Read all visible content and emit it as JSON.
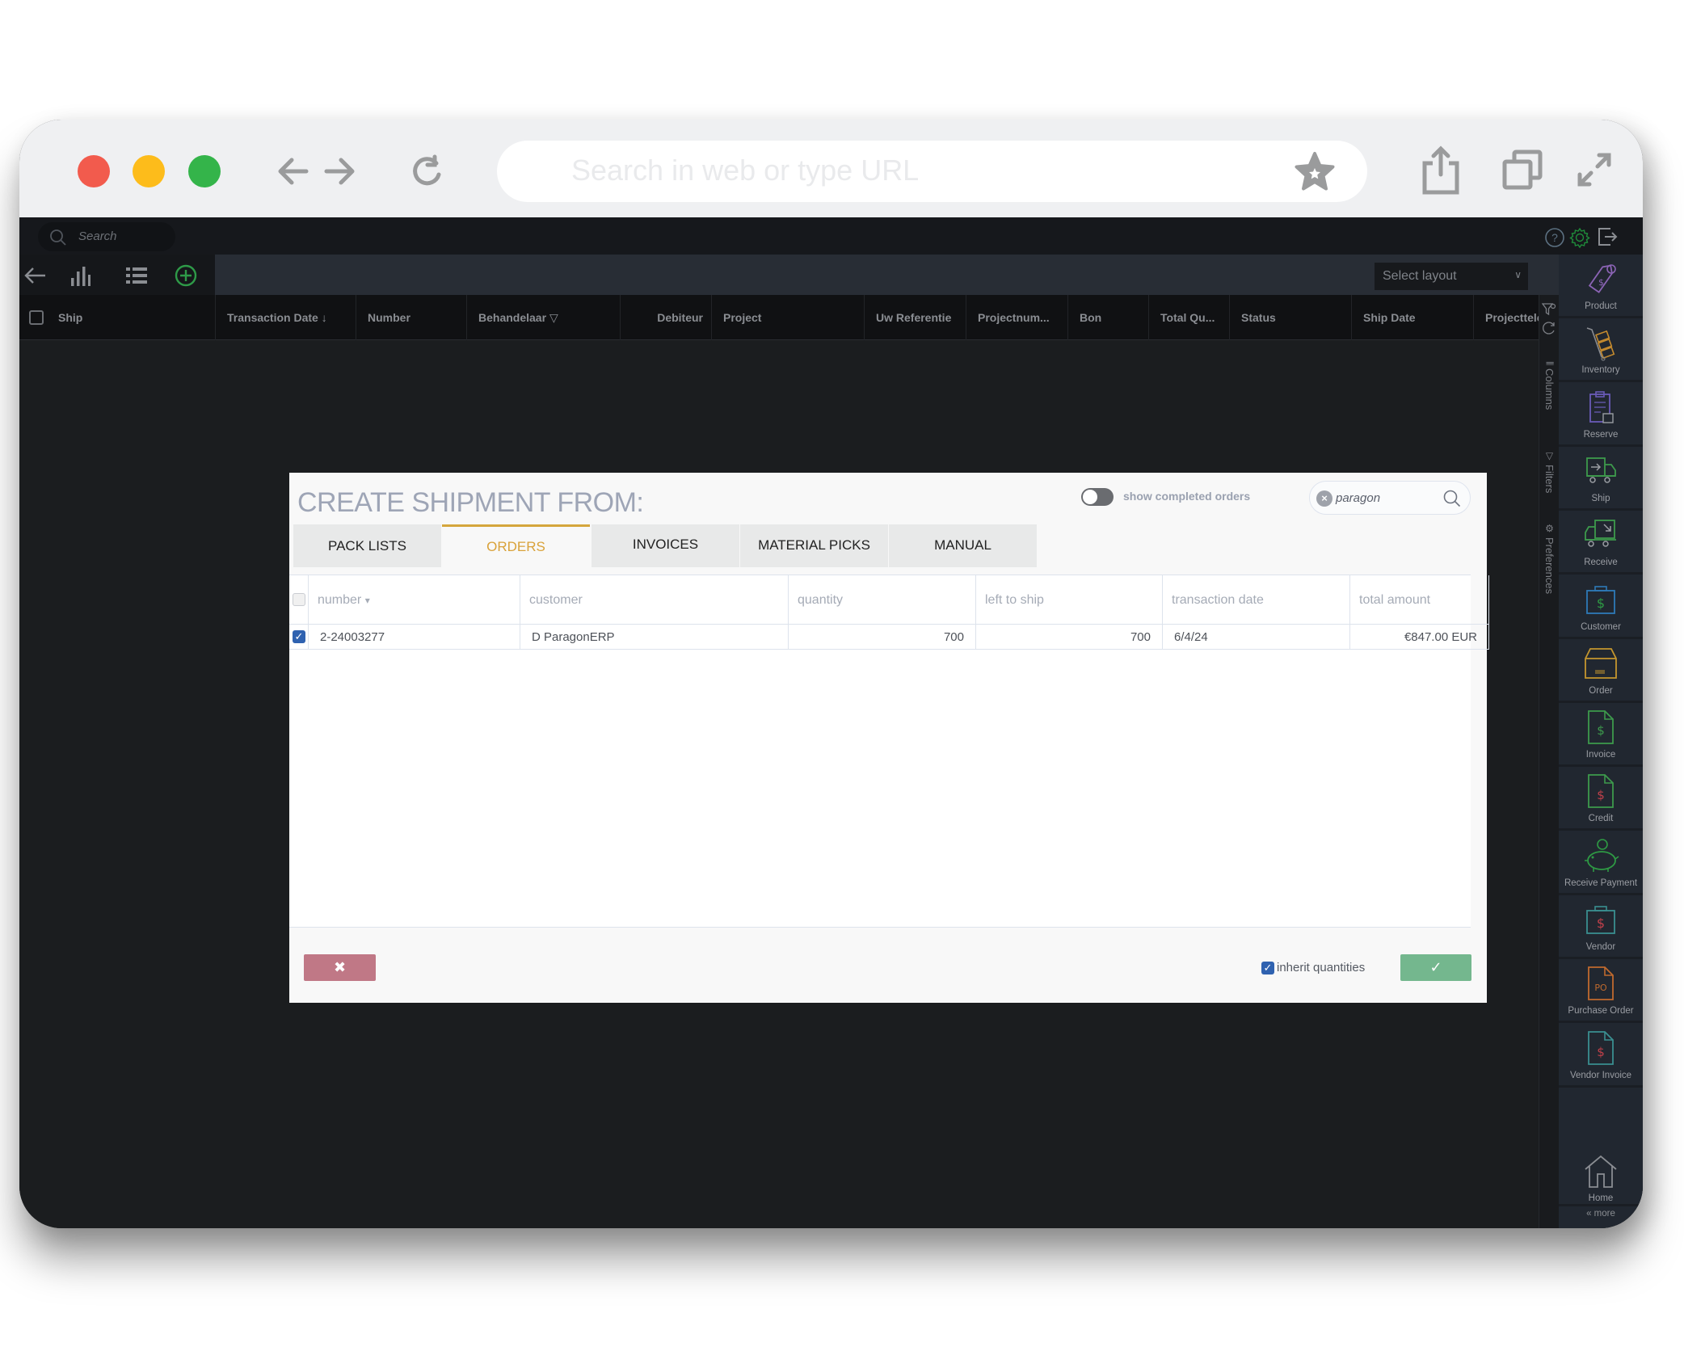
{
  "browser": {
    "url_placeholder": "Search in web or type URL",
    "traffic_lights": {
      "close": "#f25b4d",
      "minimize": "#fdbc1b",
      "maximize": "#34b44a"
    },
    "icons": [
      "back-arrow-icon",
      "forward-arrow-icon",
      "reload-icon",
      "star-icon",
      "share-icon",
      "tabs-icon",
      "fullscreen-icon"
    ]
  },
  "app": {
    "search_placeholder": "Search",
    "topbar_icons": [
      "help-icon",
      "settings-icon",
      "logout-icon"
    ],
    "toolbar_icons": [
      "back-icon",
      "chart-icon",
      "list-icon",
      "add-icon"
    ],
    "layout_select": {
      "value": "Select layout"
    },
    "columns": [
      {
        "label": "Ship"
      },
      {
        "label": "Transaction Date",
        "sort": "desc"
      },
      {
        "label": "Number"
      },
      {
        "label": "Behandelaar",
        "filter": true
      },
      {
        "label": "Debiteur"
      },
      {
        "label": "Project"
      },
      {
        "label": "Uw Referentie"
      },
      {
        "label": "Projectnum..."
      },
      {
        "label": "Bon"
      },
      {
        "label": "Total Qu..."
      },
      {
        "label": "Status"
      },
      {
        "label": "Ship Date"
      },
      {
        "label": "Projecttele"
      }
    ],
    "side_tabs": [
      "Columns",
      "Filters",
      "Preferences"
    ],
    "sidebar": {
      "items": [
        {
          "label": "Product",
          "color": "#8b64b5"
        },
        {
          "label": "Inventory",
          "color": "#c48a2e"
        },
        {
          "label": "Reserve",
          "color": "#6a5bb8"
        },
        {
          "label": "Ship",
          "color": "#3d9a4c"
        },
        {
          "label": "Receive",
          "color": "#3d9a4c"
        },
        {
          "label": "Customer",
          "color": "#2e7ab8"
        },
        {
          "label": "Order",
          "color": "#c4962e"
        },
        {
          "label": "Invoice",
          "color": "#3d9a4c"
        },
        {
          "label": "Credit",
          "color": "#3d9a4c"
        },
        {
          "label": "Receive Payment",
          "color": "#2e9a44"
        },
        {
          "label": "Vendor",
          "color": "#3a8f90"
        },
        {
          "label": "Purchase Order",
          "color": "#c06a2e"
        },
        {
          "label": "Vendor Invoice",
          "color": "#3a8f90"
        }
      ],
      "home_label": "Home",
      "more_label": "« more"
    }
  },
  "dialog": {
    "title": "CREATE SHIPMENT FROM:",
    "toggle_label": "show completed orders",
    "toggle_on": false,
    "search_value": "paragon",
    "tabs": [
      {
        "label": "PACK LISTS",
        "active": false
      },
      {
        "label": "ORDERS",
        "active": true
      },
      {
        "label": "INVOICES",
        "active": false
      },
      {
        "label": "MATERIAL PICKS",
        "active": false
      },
      {
        "label": "MANUAL",
        "active": false
      }
    ],
    "table": {
      "headers": [
        "number",
        "customer",
        "quantity",
        "left to ship",
        "transaction date",
        "total amount"
      ],
      "sort_indicator": "▾",
      "rows": [
        {
          "checked": true,
          "number": "2-24003277",
          "customer": "D ParagonERP",
          "quantity": "700",
          "left_to_ship": "700",
          "transaction_date": "6/4/24",
          "total_amount": "€847.00 EUR"
        }
      ]
    },
    "cancel_symbol": "✖",
    "confirm_symbol": "✓",
    "inherit_label": "inherit quantities",
    "inherit_checked": true
  }
}
